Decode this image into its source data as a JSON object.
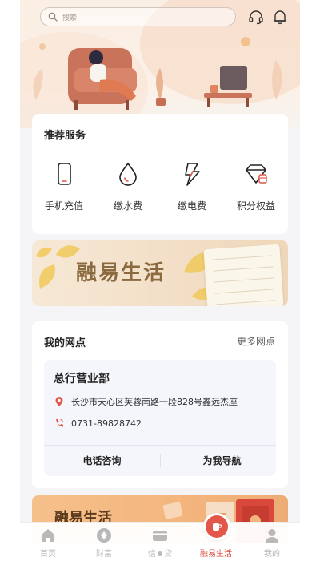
{
  "search": {
    "placeholder": "搜索"
  },
  "header_icons": [
    "headset-icon",
    "bell-icon"
  ],
  "services": {
    "title": "推荐服务",
    "items": [
      {
        "label": "手机充值",
        "icon": "phone-icon"
      },
      {
        "label": "缴水费",
        "icon": "water-drop-icon"
      },
      {
        "label": "缴电费",
        "icon": "lightning-icon"
      },
      {
        "label": "积分权益",
        "icon": "gem-icon"
      }
    ]
  },
  "banner1": {
    "title": "融易生活"
  },
  "branch": {
    "title": "我的网点",
    "more": "更多网点",
    "name": "总行营业部",
    "address": "长沙市天心区芙蓉南路一段828号鑫远杰座",
    "phone": "0731-89828742",
    "actions": {
      "call": "电话咨询",
      "navigate": "为我导航"
    }
  },
  "banner2": {
    "title": "融易生活"
  },
  "tabbar": {
    "tabs": [
      {
        "label": "首页",
        "icon": "home-icon"
      },
      {
        "label": "财富",
        "icon": "wealth-icon"
      },
      {
        "label_left": "信",
        "label_right": "贷",
        "icon": "card-icon"
      },
      {
        "label": "融易生活",
        "icon": "cup-icon",
        "active": true
      },
      {
        "label": "我的",
        "icon": "user-icon"
      }
    ]
  },
  "colors": {
    "accent": "#e2574a",
    "tab_inactive": "#b3b3b3",
    "banner_text": "#8a6a3e"
  }
}
